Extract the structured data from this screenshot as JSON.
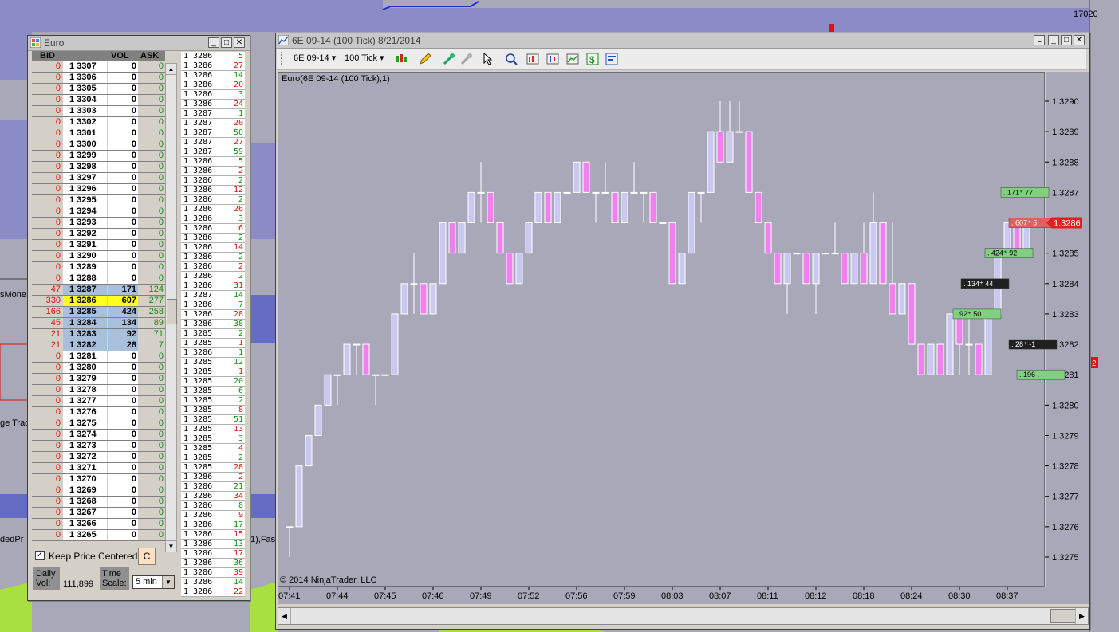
{
  "bg_ticks": [
    "17020"
  ],
  "bg_labels": {
    "money": "sMone",
    "trad": "ge Trad",
    "ded": "dedPr",
    "fas": "1),Fas",
    "r2": "2"
  },
  "dom": {
    "title": "Euro",
    "columns": {
      "bid": "BID",
      "vol": "VOL",
      "ask": "ASK"
    },
    "rows": [
      {
        "bid": "0",
        "price": "1 3307",
        "vol": "0",
        "ask": "0"
      },
      {
        "bid": "0",
        "price": "1 3306",
        "vol": "0",
        "ask": "0"
      },
      {
        "bid": "0",
        "price": "1 3305",
        "vol": "0",
        "ask": "0"
      },
      {
        "bid": "0",
        "price": "1 3304",
        "vol": "0",
        "ask": "0"
      },
      {
        "bid": "0",
        "price": "1 3303",
        "vol": "0",
        "ask": "0"
      },
      {
        "bid": "0",
        "price": "1 3302",
        "vol": "0",
        "ask": "0"
      },
      {
        "bid": "0",
        "price": "1 3301",
        "vol": "0",
        "ask": "0"
      },
      {
        "bid": "0",
        "price": "1 3300",
        "vol": "0",
        "ask": "0"
      },
      {
        "bid": "0",
        "price": "1 3299",
        "vol": "0",
        "ask": "0"
      },
      {
        "bid": "0",
        "price": "1 3298",
        "vol": "0",
        "ask": "0"
      },
      {
        "bid": "0",
        "price": "1 3297",
        "vol": "0",
        "ask": "0"
      },
      {
        "bid": "0",
        "price": "1 3296",
        "vol": "0",
        "ask": "0"
      },
      {
        "bid": "0",
        "price": "1 3295",
        "vol": "0",
        "ask": "0"
      },
      {
        "bid": "0",
        "price": "1 3294",
        "vol": "0",
        "ask": "0"
      },
      {
        "bid": "0",
        "price": "1 3293",
        "vol": "0",
        "ask": "0"
      },
      {
        "bid": "0",
        "price": "1 3292",
        "vol": "0",
        "ask": "0"
      },
      {
        "bid": "0",
        "price": "1 3291",
        "vol": "0",
        "ask": "0"
      },
      {
        "bid": "0",
        "price": "1 3290",
        "vol": "0",
        "ask": "0"
      },
      {
        "bid": "0",
        "price": "1 3289",
        "vol": "0",
        "ask": "0"
      },
      {
        "bid": "0",
        "price": "1 3288",
        "vol": "0",
        "ask": "0"
      },
      {
        "bid": "47",
        "price": "1 3287",
        "vol": "171",
        "ask": "124",
        "hl": true
      },
      {
        "bid": "330",
        "price": "1 3286",
        "vol": "607",
        "ask": "277",
        "cur": true
      },
      {
        "bid": "166",
        "price": "1 3285",
        "vol": "424",
        "ask": "258",
        "hl": true
      },
      {
        "bid": "45",
        "price": "1 3284",
        "vol": "134",
        "ask": "89",
        "hl": true
      },
      {
        "bid": "21",
        "price": "1 3283",
        "vol": "92",
        "ask": "71",
        "hl": true
      },
      {
        "bid": "21",
        "price": "1 3282",
        "vol": "28",
        "ask": "7",
        "hl": true
      },
      {
        "bid": "0",
        "price": "1 3281",
        "vol": "0",
        "ask": "0"
      },
      {
        "bid": "0",
        "price": "1 3280",
        "vol": "0",
        "ask": "0"
      },
      {
        "bid": "0",
        "price": "1 3279",
        "vol": "0",
        "ask": "0"
      },
      {
        "bid": "0",
        "price": "1 3278",
        "vol": "0",
        "ask": "0"
      },
      {
        "bid": "0",
        "price": "1 3277",
        "vol": "0",
        "ask": "0"
      },
      {
        "bid": "0",
        "price": "1 3276",
        "vol": "0",
        "ask": "0"
      },
      {
        "bid": "0",
        "price": "1 3275",
        "vol": "0",
        "ask": "0"
      },
      {
        "bid": "0",
        "price": "1 3274",
        "vol": "0",
        "ask": "0"
      },
      {
        "bid": "0",
        "price": "1 3273",
        "vol": "0",
        "ask": "0"
      },
      {
        "bid": "0",
        "price": "1 3272",
        "vol": "0",
        "ask": "0"
      },
      {
        "bid": "0",
        "price": "1 3271",
        "vol": "0",
        "ask": "0"
      },
      {
        "bid": "0",
        "price": "1 3270",
        "vol": "0",
        "ask": "0"
      },
      {
        "bid": "0",
        "price": "1 3269",
        "vol": "0",
        "ask": "0"
      },
      {
        "bid": "0",
        "price": "1 3268",
        "vol": "0",
        "ask": "0"
      },
      {
        "bid": "0",
        "price": "1 3267",
        "vol": "0",
        "ask": "0"
      },
      {
        "bid": "0",
        "price": "1 3266",
        "vol": "0",
        "ask": "0"
      },
      {
        "bid": "0",
        "price": "1 3265",
        "vol": "0",
        "ask": "0"
      }
    ],
    "tape": [
      {
        "p": "1 3286",
        "v": "5",
        "d": "up"
      },
      {
        "p": "1 3286",
        "v": "27",
        "d": "dn"
      },
      {
        "p": "1 3286",
        "v": "14",
        "d": "up"
      },
      {
        "p": "1 3286",
        "v": "20",
        "d": "dn"
      },
      {
        "p": "1 3286",
        "v": "3",
        "d": "up"
      },
      {
        "p": "1 3286",
        "v": "24",
        "d": "dn"
      },
      {
        "p": "1 3287",
        "v": "1",
        "d": "up"
      },
      {
        "p": "1 3287",
        "v": "20",
        "d": "dn"
      },
      {
        "p": "1 3287",
        "v": "50",
        "d": "up"
      },
      {
        "p": "1 3287",
        "v": "27",
        "d": "dn"
      },
      {
        "p": "1 3287",
        "v": "59",
        "d": "up"
      },
      {
        "p": "1 3286",
        "v": "5",
        "d": "up"
      },
      {
        "p": "1 3286",
        "v": "2",
        "d": "dn"
      },
      {
        "p": "1 3286",
        "v": "2",
        "d": "up"
      },
      {
        "p": "1 3286",
        "v": "12",
        "d": "dn"
      },
      {
        "p": "1 3286",
        "v": "2",
        "d": "up"
      },
      {
        "p": "1 3286",
        "v": "26",
        "d": "dn"
      },
      {
        "p": "1 3286",
        "v": "3",
        "d": "up"
      },
      {
        "p": "1 3286",
        "v": "6",
        "d": "dn"
      },
      {
        "p": "1 3286",
        "v": "2",
        "d": "up"
      },
      {
        "p": "1 3286",
        "v": "14",
        "d": "dn"
      },
      {
        "p": "1 3286",
        "v": "2",
        "d": "up"
      },
      {
        "p": "1 3286",
        "v": "2",
        "d": "dn"
      },
      {
        "p": "1 3286",
        "v": "2",
        "d": "up"
      },
      {
        "p": "1 3286",
        "v": "31",
        "d": "dn"
      },
      {
        "p": "1 3287",
        "v": "14",
        "d": "up"
      },
      {
        "p": "1 3286",
        "v": "7",
        "d": "up"
      },
      {
        "p": "1 3286",
        "v": "28",
        "d": "dn"
      },
      {
        "p": "1 3286",
        "v": "38",
        "d": "up"
      },
      {
        "p": "1 3285",
        "v": "2",
        "d": "up"
      },
      {
        "p": "1 3285",
        "v": "1",
        "d": "dn"
      },
      {
        "p": "1 3286",
        "v": "1",
        "d": "up"
      },
      {
        "p": "1 3285",
        "v": "12",
        "d": "up"
      },
      {
        "p": "1 3285",
        "v": "1",
        "d": "dn"
      },
      {
        "p": "1 3285",
        "v": "20",
        "d": "up"
      },
      {
        "p": "1 3285",
        "v": "6",
        "d": "up"
      },
      {
        "p": "1 3285",
        "v": "2",
        "d": "up"
      },
      {
        "p": "1 3285",
        "v": "8",
        "d": "dn"
      },
      {
        "p": "1 3285",
        "v": "51",
        "d": "up"
      },
      {
        "p": "1 3285",
        "v": "13",
        "d": "dn"
      },
      {
        "p": "1 3285",
        "v": "3",
        "d": "up"
      },
      {
        "p": "1 3285",
        "v": "4",
        "d": "dn"
      },
      {
        "p": "1 3285",
        "v": "2",
        "d": "up"
      },
      {
        "p": "1 3285",
        "v": "28",
        "d": "dn"
      },
      {
        "p": "1 3286",
        "v": "2",
        "d": "dn"
      },
      {
        "p": "1 3286",
        "v": "21",
        "d": "up"
      },
      {
        "p": "1 3286",
        "v": "34",
        "d": "dn"
      },
      {
        "p": "1 3286",
        "v": "8",
        "d": "up"
      },
      {
        "p": "1 3286",
        "v": "9",
        "d": "dn"
      },
      {
        "p": "1 3286",
        "v": "17",
        "d": "up"
      },
      {
        "p": "1 3286",
        "v": "15",
        "d": "dn"
      },
      {
        "p": "1 3286",
        "v": "13",
        "d": "up"
      },
      {
        "p": "1 3286",
        "v": "17",
        "d": "dn"
      },
      {
        "p": "1 3286",
        "v": "36",
        "d": "up"
      },
      {
        "p": "1 3286",
        "v": "39",
        "d": "dn"
      },
      {
        "p": "1 3286",
        "v": "14",
        "d": "up"
      },
      {
        "p": "1 3286",
        "v": "22",
        "d": "dn"
      }
    ],
    "keep_centered_label": "Keep Price Centered",
    "keep_centered_checked": true,
    "center_button": "C",
    "daily_vol_label": "Daily Vol:",
    "daily_vol_value": "111,899",
    "time_scale_label": "Time Scale:",
    "time_scale_value": "5 min"
  },
  "chart_window": {
    "title": "6E 09-14 (100 Tick)  8/21/2014",
    "toolbar": {
      "instrument": "6E 09-14",
      "interval": "100 Tick"
    },
    "label": "Euro(6E 09-14 (100 Tick),1)",
    "copyright": "© 2014 NinjaTrader, LLC",
    "colors": {
      "up_bar": "#c8c8f0",
      "down_bar": "#f080f0",
      "background": "#a8a8b8"
    }
  },
  "chart_data": {
    "type": "candlestick",
    "y_ticks": [
      "1.3290",
      "1.3289",
      "1.3288",
      "1.3287",
      "1.3286",
      "1.3285",
      "1.3284",
      "1.3283",
      "1.3282",
      "1.3281",
      "1.3280",
      "1.3279",
      "1.3278",
      "1.3277",
      "1.3276",
      "1.3275"
    ],
    "ylim": [
      1.32745,
      1.32915
    ],
    "x_ticks": [
      "07:41",
      "07:44",
      "07:45",
      "07:46",
      "07:49",
      "07:52",
      "07:56",
      "07:59",
      "08:03",
      "08:07",
      "08:11",
      "08:12",
      "08:18",
      "08:24",
      "08:30",
      "08:37"
    ],
    "last_price": "1.3286",
    "bars": [
      [
        1.3276,
        1.3276,
        1.3275,
        1.3276
      ],
      [
        1.3276,
        1.3278,
        1.3276,
        1.3278
      ],
      [
        1.3278,
        1.3279,
        1.3278,
        1.3279
      ],
      [
        1.3279,
        1.328,
        1.3279,
        1.328
      ],
      [
        1.328,
        1.3281,
        1.328,
        1.3281
      ],
      [
        1.3281,
        1.3281,
        1.328,
        1.3281
      ],
      [
        1.3281,
        1.3282,
        1.3281,
        1.3282
      ],
      [
        1.3282,
        1.3282,
        1.3281,
        1.3282
      ],
      [
        1.3282,
        1.3281,
        1.3281,
        1.3281
      ],
      [
        1.3281,
        1.3281,
        1.328,
        1.3281
      ],
      [
        1.3281,
        1.3281,
        1.3281,
        1.3281
      ],
      [
        1.3281,
        1.3283,
        1.3281,
        1.3283
      ],
      [
        1.3283,
        1.3284,
        1.3283,
        1.3284
      ],
      [
        1.3284,
        1.3285,
        1.3283,
        1.3284
      ],
      [
        1.3284,
        1.3283,
        1.3283,
        1.3283
      ],
      [
        1.3283,
        1.3284,
        1.3283,
        1.3284
      ],
      [
        1.3284,
        1.3286,
        1.3284,
        1.3286
      ],
      [
        1.3286,
        1.3285,
        1.3285,
        1.3285
      ],
      [
        1.3285,
        1.3286,
        1.3285,
        1.3286
      ],
      [
        1.3286,
        1.3287,
        1.3286,
        1.3287
      ],
      [
        1.3287,
        1.3288,
        1.3286,
        1.3287
      ],
      [
        1.3287,
        1.3286,
        1.3286,
        1.3286
      ],
      [
        1.3286,
        1.3285,
        1.3285,
        1.3285
      ],
      [
        1.3285,
        1.3284,
        1.3284,
        1.3284
      ],
      [
        1.3284,
        1.3285,
        1.3284,
        1.3285
      ],
      [
        1.3285,
        1.3286,
        1.3285,
        1.3286
      ],
      [
        1.3286,
        1.3287,
        1.3286,
        1.3287
      ],
      [
        1.3287,
        1.3286,
        1.3286,
        1.3286
      ],
      [
        1.3286,
        1.3287,
        1.3286,
        1.3287
      ],
      [
        1.3287,
        1.3287,
        1.3287,
        1.3287
      ],
      [
        1.3287,
        1.3288,
        1.3287,
        1.3288
      ],
      [
        1.3288,
        1.3287,
        1.3287,
        1.3287
      ],
      [
        1.3287,
        1.3287,
        1.3286,
        1.3287
      ],
      [
        1.3287,
        1.3288,
        1.3287,
        1.3287
      ],
      [
        1.3287,
        1.3286,
        1.3286,
        1.3286
      ],
      [
        1.3286,
        1.3287,
        1.3286,
        1.3287
      ],
      [
        1.3287,
        1.3288,
        1.3287,
        1.3287
      ],
      [
        1.3287,
        1.3287,
        1.3286,
        1.3287
      ],
      [
        1.3287,
        1.3286,
        1.3286,
        1.3286
      ],
      [
        1.3286,
        1.3285,
        1.3285,
        1.3286
      ],
      [
        1.3286,
        1.3284,
        1.3284,
        1.3284
      ],
      [
        1.3284,
        1.3285,
        1.3284,
        1.3285
      ],
      [
        1.3285,
        1.3287,
        1.3285,
        1.3287
      ],
      [
        1.3287,
        1.3287,
        1.3286,
        1.3287
      ],
      [
        1.3287,
        1.3289,
        1.3287,
        1.3289
      ],
      [
        1.3289,
        1.329,
        1.3288,
        1.3288
      ],
      [
        1.3288,
        1.329,
        1.3288,
        1.3289
      ],
      [
        1.3289,
        1.329,
        1.3289,
        1.3289
      ],
      [
        1.3289,
        1.3289,
        1.3287,
        1.3287
      ],
      [
        1.3287,
        1.3287,
        1.3286,
        1.3286
      ],
      [
        1.3286,
        1.3285,
        1.3285,
        1.3285
      ],
      [
        1.3285,
        1.3284,
        1.3284,
        1.3284
      ],
      [
        1.3284,
        1.3285,
        1.3283,
        1.3285
      ],
      [
        1.3285,
        1.3285,
        1.3285,
        1.3285
      ],
      [
        1.3285,
        1.3284,
        1.3284,
        1.3284
      ],
      [
        1.3284,
        1.3285,
        1.3283,
        1.3285
      ],
      [
        1.3285,
        1.3285,
        1.3285,
        1.3285
      ],
      [
        1.3285,
        1.3286,
        1.3285,
        1.3285
      ],
      [
        1.3285,
        1.3285,
        1.3284,
        1.3284
      ],
      [
        1.3284,
        1.3285,
        1.3284,
        1.3285
      ],
      [
        1.3285,
        1.3286,
        1.3284,
        1.3284
      ],
      [
        1.3284,
        1.3287,
        1.3284,
        1.3286
      ],
      [
        1.3286,
        1.3284,
        1.3284,
        1.3284
      ],
      [
        1.3284,
        1.3286,
        1.3283,
        1.3283
      ],
      [
        1.3283,
        1.3284,
        1.3283,
        1.3284
      ],
      [
        1.3284,
        1.3282,
        1.3282,
        1.3282
      ],
      [
        1.3282,
        1.3281,
        1.3281,
        1.3281
      ],
      [
        1.3281,
        1.3282,
        1.3281,
        1.3282
      ],
      [
        1.3282,
        1.3281,
        1.3281,
        1.3281
      ],
      [
        1.3281,
        1.3283,
        1.3281,
        1.3283
      ],
      [
        1.3283,
        1.3282,
        1.3281,
        1.3282
      ],
      [
        1.3282,
        1.3283,
        1.3281,
        1.3282
      ],
      [
        1.3282,
        1.3281,
        1.3281,
        1.3281
      ],
      [
        1.3281,
        1.3283,
        1.3281,
        1.3283
      ],
      [
        1.3283,
        1.3285,
        1.3283,
        1.3285
      ],
      [
        1.3285,
        1.3286,
        1.3285,
        1.3286
      ],
      [
        1.3286,
        1.3285,
        1.3285,
        1.3285
      ],
      [
        1.3285,
        1.3286,
        1.3285,
        1.3286
      ]
    ],
    "volume_markers": [
      {
        "text": ". 171⁺  77",
        "price": 1.3287,
        "style": "green"
      },
      {
        "text": ". 607⁺  5",
        "price": 1.3286,
        "style": "red"
      },
      {
        "text": ". 424⁺  92",
        "price": 1.3285,
        "style": "green"
      },
      {
        "text": ". 134⁺  44",
        "price": 1.3284,
        "style": "black"
      },
      {
        "text": ". 92⁺  50",
        "price": 1.3283,
        "style": "green"
      },
      {
        "text": ". 28⁺  -1",
        "price": 1.3282,
        "style": "black"
      },
      {
        "text": ". 196 .",
        "price": 1.3281,
        "style": "green"
      }
    ]
  }
}
